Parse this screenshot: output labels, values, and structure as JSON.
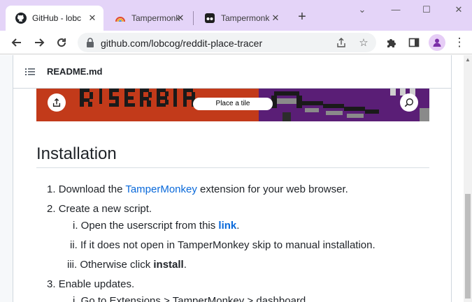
{
  "tabs": [
    {
      "title": "GitHub - lobcog/reddit-place-tracer",
      "active": true
    },
    {
      "title": "Tampermonkey",
      "active": false
    },
    {
      "title": "Tampermonkey",
      "active": false
    }
  ],
  "toolbar": {
    "url": "github.com/lobcog/reddit-place-tracer"
  },
  "readme": {
    "filename": "README.md",
    "banner_button": "Place a tile",
    "heading": "Installation",
    "steps": [
      {
        "num": "1.",
        "parts": [
          "Download the ",
          "TamperMonkey",
          " extension for your web browser."
        ]
      },
      {
        "num": "2.",
        "text": "Create a new script."
      },
      {
        "num": "i.",
        "parts": [
          "Open the userscript from this ",
          "link",
          "."
        ]
      },
      {
        "num": "ii.",
        "text": "If it does not open in TamperMonkey skip to manual installation."
      },
      {
        "num": "iii.",
        "parts": [
          "Otherwise click ",
          "install",
          "."
        ]
      },
      {
        "num": "3.",
        "text": "Enable updates."
      },
      {
        "num": "i.",
        "text": "Go to Extensions > TamperMonkey > dashboard"
      }
    ]
  },
  "colors": {
    "tabstrip": "#e4d4f8",
    "link": "#0969da",
    "banner_red": "#c23a1a",
    "banner_purple": "#5a1e76"
  }
}
